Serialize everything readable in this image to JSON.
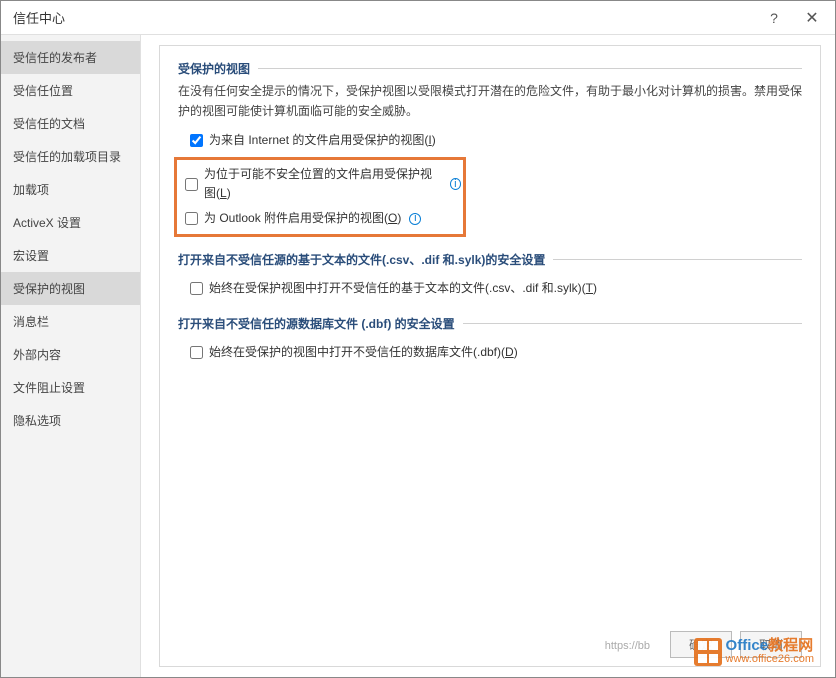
{
  "titlebar": {
    "title": "信任中心",
    "help": "?",
    "close": "✕"
  },
  "sidebar": {
    "items": [
      {
        "label": "受信任的发布者",
        "selected": true
      },
      {
        "label": "受信任位置"
      },
      {
        "label": "受信任的文档"
      },
      {
        "label": "受信任的加载项目录"
      },
      {
        "label": "加载项"
      },
      {
        "label": "ActiveX 设置"
      },
      {
        "label": "宏设置"
      },
      {
        "label": "受保护的视图",
        "selected": true
      },
      {
        "label": "消息栏"
      },
      {
        "label": "外部内容"
      },
      {
        "label": "文件阻止设置"
      },
      {
        "label": "隐私选项"
      }
    ]
  },
  "content": {
    "section1": {
      "title": "受保护的视图",
      "desc": "在没有任何安全提示的情况下，受保护视图以受限模式打开潜在的危险文件，有助于最小化对计算机的损害。禁用受保护的视图可能使计算机面临可能的安全威胁。",
      "cb1": {
        "label": "为来自 Internet 的文件启用受保护的视图(",
        "key": "I",
        "suffix": ")",
        "checked": true
      },
      "cb2": {
        "label": "为位于可能不安全位置的文件启用受保护视图(",
        "key": "L",
        "suffix": ")",
        "checked": false
      },
      "cb3": {
        "label": "为 Outlook 附件启用受保护的视图(",
        "key": "O",
        "suffix": ")",
        "checked": false
      }
    },
    "section2": {
      "title": "打开来自不受信任源的基于文本的文件(.csv、.dif 和.sylk)的安全设置",
      "cb1": {
        "label": "始终在受保护视图中打开不受信任的基于文本的文件(.csv、.dif 和.sylk)(",
        "key": "T",
        "suffix": ")",
        "checked": false
      }
    },
    "section3": {
      "title": "打开来自不受信任的源数据库文件 (.dbf) 的安全设置",
      "cb1": {
        "label": "始终在受保护的视图中打开不受信任的数据库文件(.dbf)(",
        "key": "D",
        "suffix": ")",
        "checked": false
      }
    }
  },
  "footer": {
    "ok": "确定",
    "cancel": "取消"
  },
  "watermark": {
    "title1": "Office",
    "title2": "教程网",
    "url": "www.office26.com"
  },
  "faint_link": "https://bb"
}
